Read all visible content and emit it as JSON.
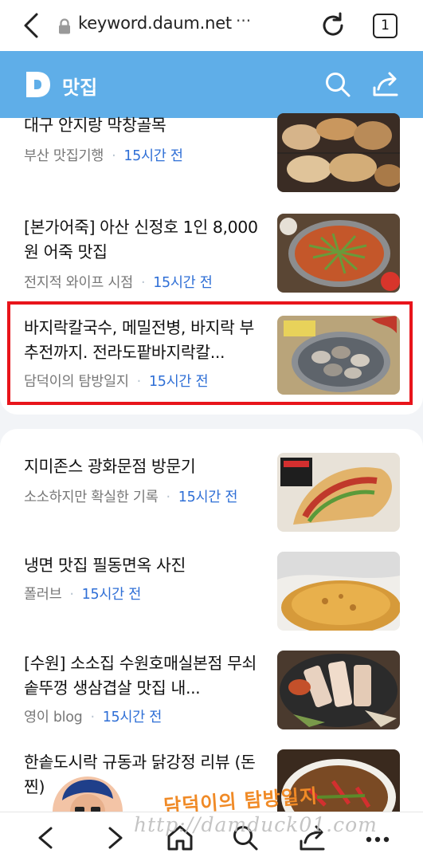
{
  "browser": {
    "url": "keyword.daum.net",
    "url_more": "···",
    "tab_count": "1"
  },
  "header": {
    "logo_letter": "D",
    "title": "맛집"
  },
  "group1": [
    {
      "title": "대구 안지랑 막창골목",
      "source": "부산 맛집기행",
      "time": "15시간 전",
      "thumb": "grilled-makchang"
    },
    {
      "title": "[본가어죽] 아산 신정호 1인 8,000원 어죽 맛집",
      "source": "전지적 와이프 시점",
      "time": "15시간 전",
      "thumb": "fish-porridge-hotpot"
    },
    {
      "title": "바지락칼국수, 메밀전병, 바지락 부추전까지. 전라도팥바지락칼...",
      "source": "담덕이의 탐방일지",
      "time": "15시간 전",
      "thumb": "clams-bowl"
    }
  ],
  "group2": [
    {
      "title": "지미존스 광화문점 방문기",
      "source": "소소하지만 확실한 기록",
      "time": "15시간 전",
      "thumb": "sandwich"
    },
    {
      "title": "냉면 맛집 필동면옥 사진",
      "source": "폴러브",
      "time": "15시간 전",
      "thumb": "pancake"
    },
    {
      "title": "[수원] 소소집 수원호매실본점 무쇠솥뚜껑 생삼겹살 맛집 내...",
      "source": "영이 blog",
      "time": "15시간 전",
      "thumb": "pork-belly-grill"
    },
    {
      "title": "한솥도시락 규동과 닭강정 리뷰 (돈찐)",
      "source": "",
      "time": "",
      "thumb": "gyudon"
    }
  ],
  "watermark": {
    "name": "담덕이의 탐방일지",
    "url": "http://damduck01.com"
  }
}
